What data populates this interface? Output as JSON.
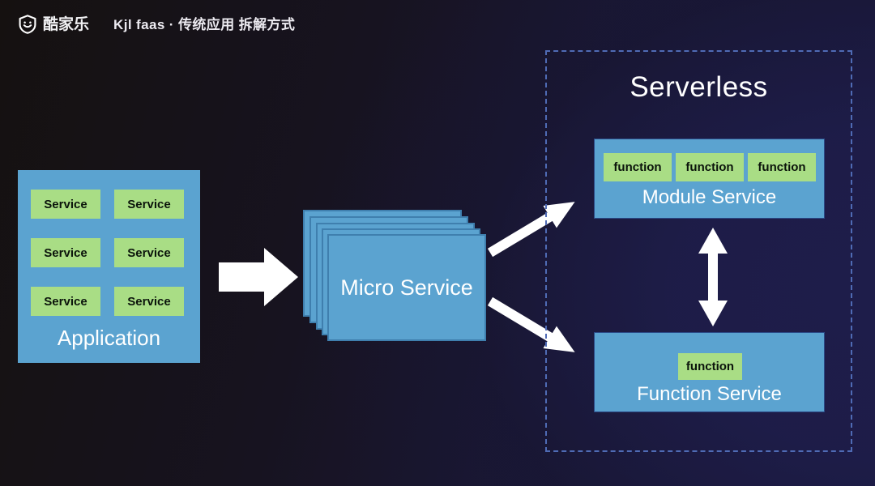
{
  "header": {
    "logo_icon": "kujiale-shield-smile-icon",
    "logo_text": "酷家乐",
    "title": "Kjl faas · 传统应用 拆解方式"
  },
  "colors": {
    "blue_box": "#5ba3d0",
    "green_chip": "#a9dd85",
    "dashed_border": "#4f6bb5",
    "arrow": "#ffffff",
    "text_light": "#ffffff",
    "bg_left": "#151110",
    "bg_right": "#1a1940"
  },
  "application": {
    "caption": "Application",
    "services": [
      {
        "label": "Service"
      },
      {
        "label": "Service"
      },
      {
        "label": "Service"
      },
      {
        "label": "Service"
      },
      {
        "label": "Service"
      },
      {
        "label": "Service"
      }
    ]
  },
  "micro_service": {
    "caption": "Micro Service",
    "stack_layers": 5
  },
  "serverless": {
    "title": "Serverless",
    "module_service": {
      "caption": "Module Service",
      "functions": [
        {
          "label": "function"
        },
        {
          "label": "function"
        },
        {
          "label": "function"
        }
      ]
    },
    "function_service": {
      "caption": "Function Service",
      "functions": [
        {
          "label": "function"
        }
      ]
    }
  },
  "arrows": {
    "app_to_micro": "right-arrow-icon",
    "micro_to_module": "diagonal-up-right-arrow-icon",
    "micro_to_function": "diagonal-down-right-arrow-icon",
    "module_function_link": "double-headed-vertical-arrow-icon"
  }
}
